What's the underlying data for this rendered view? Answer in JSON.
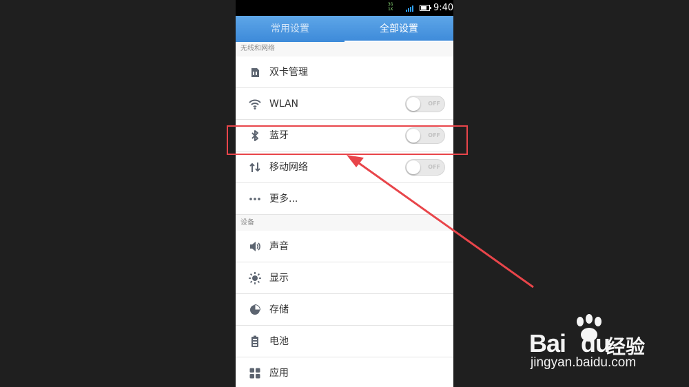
{
  "status_bar": {
    "network_top": "3G",
    "network_bottom": "1X",
    "time": "9:40"
  },
  "tabs": [
    {
      "label": "常用设置",
      "active": false
    },
    {
      "label": "全部设置",
      "active": true
    }
  ],
  "sections": [
    {
      "header": "无线和网络",
      "items": [
        {
          "label": "双卡管理",
          "icon": "dual-sim-icon"
        },
        {
          "label": "WLAN",
          "icon": "wifi-icon",
          "toggle": "OFF"
        },
        {
          "label": "蓝牙",
          "icon": "bluetooth-icon",
          "toggle": "OFF"
        },
        {
          "label": "移动网络",
          "icon": "mobile-data-icon",
          "toggle": "OFF"
        },
        {
          "label": "更多...",
          "icon": "more-icon"
        }
      ]
    },
    {
      "header": "设备",
      "items": [
        {
          "label": "声音",
          "icon": "speaker-icon"
        },
        {
          "label": "显示",
          "icon": "brightness-icon"
        },
        {
          "label": "存储",
          "icon": "storage-pie-icon"
        },
        {
          "label": "电池",
          "icon": "battery-icon"
        },
        {
          "label": "应用",
          "icon": "apps-grid-icon"
        }
      ]
    }
  ],
  "annotation": {
    "color": "#e8454a"
  },
  "watermark": {
    "brand": "Bai",
    "brand_suffix": "du",
    "cn": "经验",
    "url": "jingyan.baidu.com"
  }
}
